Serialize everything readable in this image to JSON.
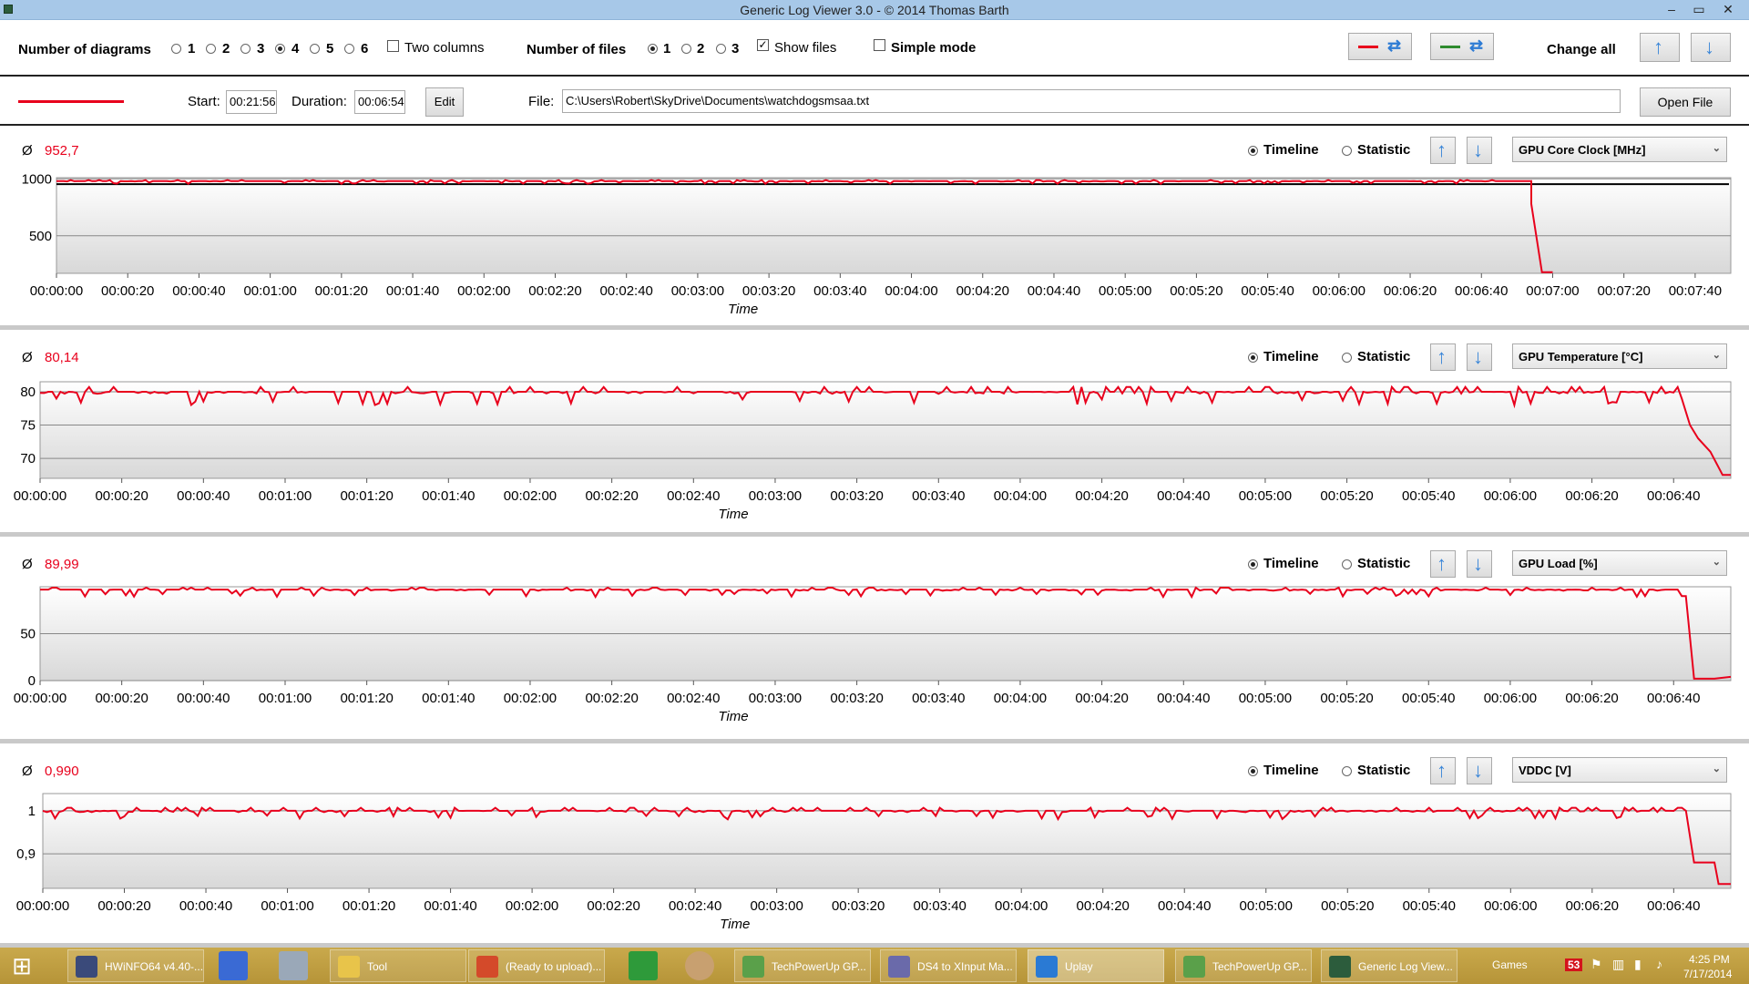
{
  "window": {
    "title": "Generic Log Viewer 3.0 - © 2014 Thomas Barth",
    "min": "–",
    "max": "▭",
    "close": "✕"
  },
  "toolbar": {
    "num_diagrams_label": "Number of diagrams",
    "diagram_options": [
      "1",
      "2",
      "3",
      "4",
      "5",
      "6"
    ],
    "diagram_selected": "4",
    "two_columns_label": "Two columns",
    "num_files_label": "Number of files",
    "file_options": [
      "1",
      "2",
      "3"
    ],
    "file_selected": "1",
    "show_files_label": "Show files",
    "show_files_checked": true,
    "simple_mode_label": "Simple mode",
    "simple_mode_checked": false,
    "change_all_label": "Change all",
    "swap_red_color": "#e8001c",
    "swap_green_color": "#2e8b2e"
  },
  "filebar": {
    "series_color": "#e8001c",
    "start_label": "Start:",
    "start_value": "00:21:56",
    "duration_label": "Duration:",
    "duration_value": "00:06:54",
    "edit_label": "Edit",
    "file_label": "File:",
    "file_path": "C:\\Users\\Robert\\SkyDrive\\Documents\\watchdogsmsaa.txt",
    "open_file_label": "Open File"
  },
  "panels": [
    {
      "avg_symbol": "Ø",
      "avg_value": "952,7",
      "timeline_label": "Timeline",
      "statistic_label": "Statistic",
      "sensor": "GPU Core Clock [MHz]"
    },
    {
      "avg_symbol": "Ø",
      "avg_value": "80,14",
      "timeline_label": "Timeline",
      "statistic_label": "Statistic",
      "sensor": "GPU Temperature [°C]"
    },
    {
      "avg_symbol": "Ø",
      "avg_value": "89,99",
      "timeline_label": "Timeline",
      "statistic_label": "Statistic",
      "sensor": "GPU Load [%]"
    },
    {
      "avg_symbol": "Ø",
      "avg_value": "0,990",
      "timeline_label": "Timeline",
      "statistic_label": "Statistic",
      "sensor": "VDDC [V]"
    }
  ],
  "chart_data": [
    {
      "type": "line",
      "title": "",
      "xlabel": "Time",
      "ylabel": "GPU Core Clock [MHz]",
      "xlim": [
        "00:00:00",
        "00:07:50"
      ],
      "ylim": [
        170,
        1010
      ],
      "yticks": [
        "1000",
        "500"
      ],
      "ytick_values": [
        1000,
        500
      ],
      "xticks": [
        "00:00:00",
        "00:00:20",
        "00:00:40",
        "00:01:00",
        "00:01:20",
        "00:01:40",
        "00:02:00",
        "00:02:20",
        "00:02:40",
        "00:03:00",
        "00:03:20",
        "00:03:40",
        "00:04:00",
        "00:04:20",
        "00:04:40",
        "00:05:00",
        "00:05:20",
        "00:05:40",
        "00:06:00",
        "00:06:20",
        "00:06:40",
        "00:07:00",
        "00:07:20",
        "00:07:40"
      ],
      "reference_line": 952.7,
      "reference_color": "#000000",
      "series": [
        {
          "color": "#e8001c",
          "base": 980,
          "noise": 12,
          "end": 414,
          "drops": [
            [
              414,
              780
            ],
            [
              417,
              180
            ],
            [
              420,
              180
            ]
          ]
        }
      ]
    },
    {
      "type": "line",
      "title": "",
      "xlabel": "Time",
      "ylabel": "GPU Temperature [°C]",
      "xlim": [
        "00:00:00",
        "00:06:54"
      ],
      "ylim": [
        67,
        81.5
      ],
      "yticks": [
        "80",
        "75",
        "70"
      ],
      "ytick_values": [
        80,
        75,
        70
      ],
      "xticks": [
        "00:00:00",
        "00:00:20",
        "00:00:40",
        "00:01:00",
        "00:01:20",
        "00:01:40",
        "00:02:00",
        "00:02:20",
        "00:02:40",
        "00:03:00",
        "00:03:20",
        "00:03:40",
        "00:04:00",
        "00:04:20",
        "00:04:40",
        "00:05:00",
        "00:05:20",
        "00:05:40",
        "00:06:00",
        "00:06:20",
        "00:06:40"
      ],
      "series": [
        {
          "color": "#e8001c",
          "base": 80,
          "noise": 1,
          "end": 402,
          "drops": [
            [
              404,
              75
            ],
            [
              406,
              73
            ],
            [
              409,
              71
            ],
            [
              412,
              67.5
            ],
            [
              414,
              67.5
            ]
          ]
        }
      ]
    },
    {
      "type": "line",
      "title": "",
      "xlabel": "Time",
      "ylabel": "GPU Load [%]",
      "xlim": [
        "00:00:00",
        "00:06:54"
      ],
      "ylim": [
        0,
        100
      ],
      "yticks": [
        "50",
        "0"
      ],
      "ytick_values": [
        50,
        0
      ],
      "xticks": [
        "00:00:00",
        "00:00:20",
        "00:00:40",
        "00:01:00",
        "00:01:20",
        "00:01:40",
        "00:02:00",
        "00:02:20",
        "00:02:40",
        "00:03:00",
        "00:03:20",
        "00:03:40",
        "00:04:00",
        "00:04:20",
        "00:04:40",
        "00:05:00",
        "00:05:20",
        "00:05:40",
        "00:06:00",
        "00:06:20",
        "00:06:40"
      ],
      "series": [
        {
          "color": "#e8001c",
          "base": 97,
          "noise": 4,
          "end": 403,
          "drops": [
            [
              405,
              2
            ],
            [
              410,
              2
            ],
            [
              414,
              4
            ]
          ]
        }
      ]
    },
    {
      "type": "line",
      "title": "",
      "xlabel": "Time",
      "ylabel": "VDDC [V]",
      "xlim": [
        "00:00:00",
        "00:06:54"
      ],
      "ylim": [
        0.82,
        1.04
      ],
      "yticks": [
        "1",
        "0,9"
      ],
      "ytick_values": [
        1,
        0.9
      ],
      "xticks": [
        "00:00:00",
        "00:00:20",
        "00:00:40",
        "00:01:00",
        "00:01:20",
        "00:01:40",
        "00:02:00",
        "00:02:20",
        "00:02:40",
        "00:03:00",
        "00:03:20",
        "00:03:40",
        "00:04:00",
        "00:04:20",
        "00:04:40",
        "00:05:00",
        "00:05:20",
        "00:05:40",
        "00:06:00",
        "00:06:20",
        "00:06:40"
      ],
      "series": [
        {
          "color": "#e8001c",
          "base": 1.0,
          "noise": 0.01,
          "end": 403,
          "drops": [
            [
              405,
              0.88
            ],
            [
              410,
              0.88
            ],
            [
              411,
              0.83
            ],
            [
              414,
              0.83
            ]
          ]
        }
      ]
    }
  ],
  "taskbar": {
    "items": [
      {
        "label": "HWiNFO64 v4.40-...",
        "color": "#3a4a7a"
      },
      {
        "label": "Tool",
        "color": "#e8c44a"
      },
      {
        "label": "(Ready to upload)...",
        "color": "#d44a2a"
      },
      {
        "label": "TechPowerUp GP...",
        "color": "#5aa04a"
      },
      {
        "label": "DS4 to XInput Ma...",
        "color": "#6a6aaa"
      },
      {
        "label": "Uplay",
        "color": "#2a7ad4"
      },
      {
        "label": "TechPowerUp GP...",
        "color": "#5aa04a"
      },
      {
        "label": "Generic Log View...",
        "color": "#2c5c3c"
      }
    ],
    "games_label": "Games",
    "badge": "53",
    "time": "4:25 PM",
    "date": "7/17/2014"
  }
}
